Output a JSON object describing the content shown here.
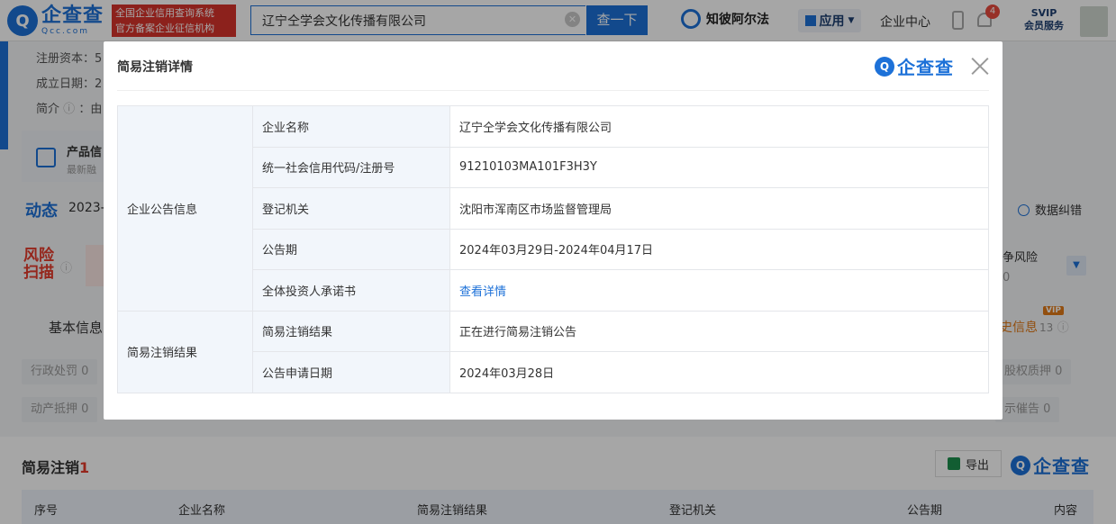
{
  "header": {
    "logo_text": "企查查",
    "logo_sub": "Qcc.com",
    "credit_line1": "全国企业信用查询系统",
    "credit_line2": "官方备案企业征信机构",
    "search_value": "辽宁仝学会文化传播有限公司",
    "search_button": "查一下",
    "zhibi": "知彼阿尔法",
    "app_label": "应用",
    "enterprise_center": "企业中心",
    "notification_count": "4",
    "svip_label": "SVIP",
    "svip_sub": "会员服务"
  },
  "background": {
    "reg_capital_label": "注册资本：5",
    "established_label": "成立日期：2",
    "intro_label": "简介",
    "intro_value": "：由",
    "product_title": "产品信",
    "product_sub": "最新融",
    "dongtai": "动态",
    "dongtai_year": "2023-",
    "data_fix": "数据纠错",
    "risk_title": "风险扫描",
    "risk_right_label": "争风险",
    "risk_right_value": "0",
    "tab_basic": "基本信息",
    "tab_right_label": "史信息",
    "tab_right_count": "13",
    "vip_tag": "VIP",
    "chips": [
      "行政处罚 0",
      "动产抵押 0",
      "股权质押 0",
      "示催告 0"
    ],
    "section_title": "简易注销",
    "section_count": "1",
    "export_label": "导出",
    "table_headers": [
      "序号",
      "企业名称",
      "简易注销结果",
      "登记机关",
      "公告期",
      "内容"
    ]
  },
  "modal": {
    "title": "简易注销详情",
    "brand": "企查查",
    "groups": [
      {
        "name": "企业公告信息",
        "rows": [
          {
            "label": "企业名称",
            "value": "辽宁仝学会文化传播有限公司"
          },
          {
            "label": "统一社会信用代码/注册号",
            "value": "91210103MA101F3H3Y"
          },
          {
            "label": "登记机关",
            "value": "沈阳市浑南区市场监督管理局"
          },
          {
            "label": "公告期",
            "value": "2024年03月29日-2024年04月17日"
          },
          {
            "label": "全体投资人承诺书",
            "value": "查看详情"
          }
        ]
      },
      {
        "name": "简易注销结果",
        "rows": [
          {
            "label": "简易注销结果",
            "value": "正在进行简易注销公告"
          },
          {
            "label": "公告申请日期",
            "value": "2024年03月28日"
          }
        ]
      }
    ]
  }
}
